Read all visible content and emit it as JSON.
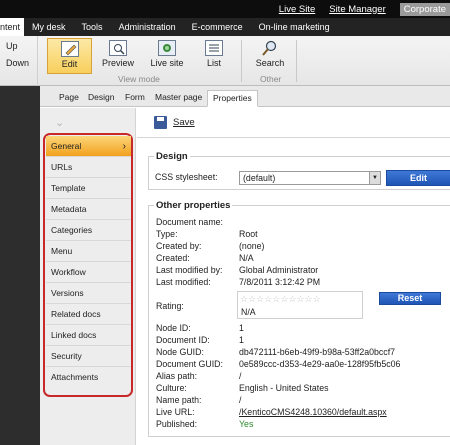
{
  "topbar": {
    "live_site": "Live Site",
    "site_manager": "Site Manager",
    "corporate": "Corporate"
  },
  "menu": [
    "ntent",
    "My desk",
    "Tools",
    "Administration",
    "E-commerce",
    "On-line marketing"
  ],
  "ribbon": {
    "up": "Up",
    "down": "Down",
    "buttons": [
      "Edit",
      "Preview",
      "Live site",
      "List",
      "Search"
    ],
    "view_mode": "View mode",
    "other": "Other"
  },
  "tabs": [
    "Page",
    "Design",
    "Form",
    "Master page",
    "Properties"
  ],
  "vnav": [
    "General",
    "URLs",
    "Template",
    "Metadata",
    "Categories",
    "Menu",
    "Workflow",
    "Versions",
    "Related docs",
    "Linked docs",
    "Security",
    "Attachments"
  ],
  "save_label": "Save",
  "design": {
    "title": "Design",
    "css_label": "CSS stylesheet:",
    "css_value": "(default)",
    "edit_button": "Edit"
  },
  "other": {
    "title": "Other properties",
    "rows": [
      {
        "label": "Document name:",
        "value": ""
      },
      {
        "label": "Type:",
        "value": "Root"
      },
      {
        "label": "Created by:",
        "value": "(none)"
      },
      {
        "label": "Created:",
        "value": "N/A"
      },
      {
        "label": "Last modified by:",
        "value": "Global Administrator"
      },
      {
        "label": "Last modified:",
        "value": "7/8/2011 3:12:42 PM"
      }
    ],
    "rating_label": "Rating:",
    "rating_value": "N/A",
    "reset_button": "Reset",
    "stars": "☆☆☆☆☆☆☆☆☆☆",
    "rows2": [
      {
        "label": "Node ID:",
        "value": "1"
      },
      {
        "label": "Document ID:",
        "value": "1"
      },
      {
        "label": "Node GUID:",
        "value": "db472111-b6eb-49f9-b98a-53ff2a0bccf7"
      },
      {
        "label": "Document GUID:",
        "value": "0e589ccc-d353-4e29-aa0e-128f95fb5c06"
      },
      {
        "label": "Alias path:",
        "value": "/"
      },
      {
        "label": "Culture:",
        "value": "English - United States"
      },
      {
        "label": "Name path:",
        "value": "/"
      },
      {
        "label": "Live URL:",
        "value": "/KenticoCMS4248.10360/default.aspx"
      },
      {
        "label": "Published:",
        "value": "Yes"
      }
    ]
  },
  "colors": {
    "accent": "#1f55b5",
    "highlight": "#f2a11e",
    "frame": "#c8282a",
    "published": "#2e8b2e"
  }
}
